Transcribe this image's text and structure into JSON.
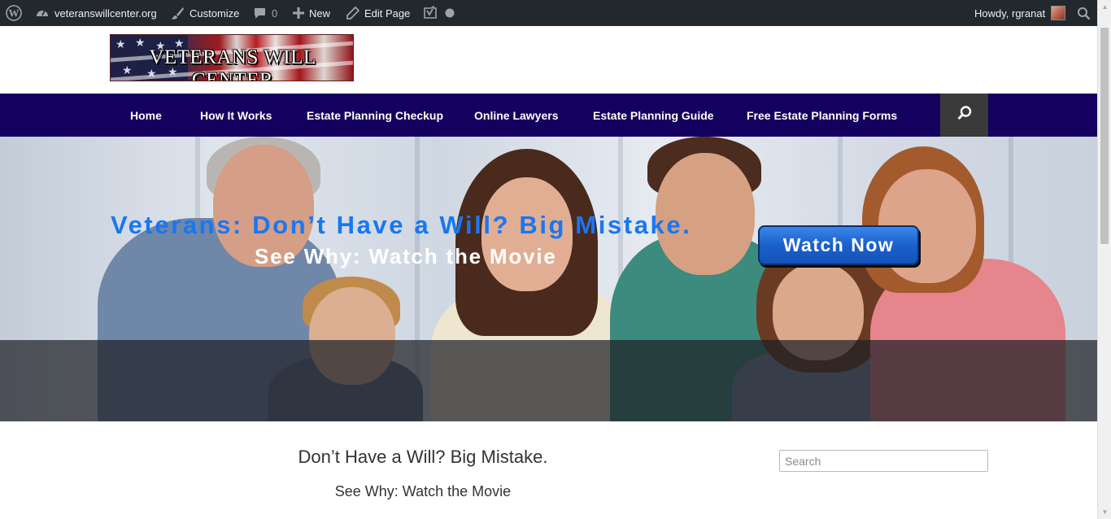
{
  "admin_bar": {
    "site_name": "veteranswillcenter.org",
    "customize_label": "Customize",
    "comments_count": "0",
    "new_label": "New",
    "edit_page_label": "Edit Page",
    "greeting": "Howdy, rgranat",
    "icons": [
      "wordpress-logo-icon",
      "dashboard-icon",
      "brush-icon",
      "comment-icon",
      "plus-icon",
      "pencil-icon",
      "yoast-icon",
      "status-dot-icon",
      "avatar",
      "search-icon"
    ]
  },
  "header": {
    "logo_text": "VETERANS WILL CENTER"
  },
  "nav": {
    "items": [
      {
        "label": "Home"
      },
      {
        "label": "How It Works"
      },
      {
        "label": "Estate Planning Checkup"
      },
      {
        "label": "Online Lawyers"
      },
      {
        "label": "Estate Planning Guide"
      },
      {
        "label": "Free Estate Planning Forms"
      }
    ],
    "search_icon": "search-icon"
  },
  "hero": {
    "headline": "Veterans: Don’t Have a Will? Big Mistake.",
    "subheadline": "See Why: Watch the Movie",
    "button_label": "Watch Now"
  },
  "content": {
    "title": "Don’t Have a Will? Big Mistake.",
    "subtitle": "See Why: Watch the Movie"
  },
  "sidebar": {
    "search_placeholder": "Search"
  },
  "colors": {
    "admin_bar_bg": "#23282d",
    "nav_bg": "#14005e",
    "headline_blue": "#1877f2",
    "button_blue": "#1b60cc"
  }
}
